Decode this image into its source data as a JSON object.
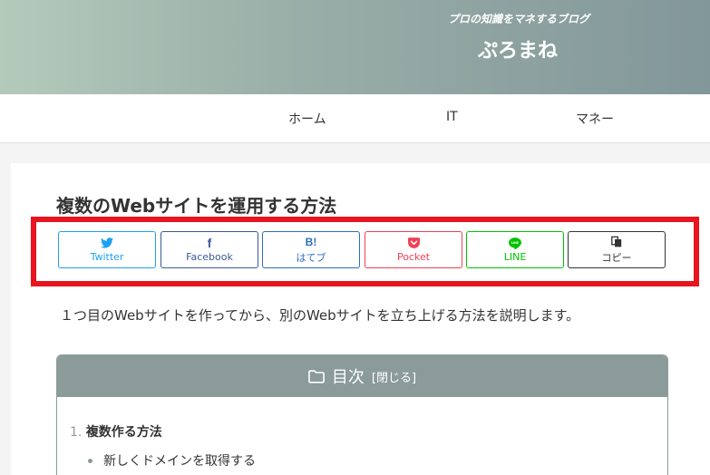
{
  "header": {
    "tagline": "プロの知識をマネするブログ",
    "site_title": "ぷろまね"
  },
  "nav": {
    "items": [
      {
        "label": "ホーム"
      },
      {
        "label": "IT"
      },
      {
        "label": "マネー"
      }
    ]
  },
  "article": {
    "title": "複数のWebサイトを運用する方法",
    "intro": "１つ目のWebサイトを作ってから、別のWebサイトを立ち上げる方法を説明します。"
  },
  "share_buttons": [
    {
      "label": "Twitter",
      "icon": "twitter-icon",
      "color": "#1da1f2"
    },
    {
      "label": "Facebook",
      "icon": "facebook-icon",
      "color": "#3b5998"
    },
    {
      "label": "はてブ",
      "icon": "hatena-bookmark-icon",
      "color": "#2c6ebd"
    },
    {
      "label": "Pocket",
      "icon": "pocket-icon",
      "color": "#ef4056"
    },
    {
      "label": "LINE",
      "icon": "line-icon",
      "color": "#00c300"
    },
    {
      "label": "コピー",
      "icon": "copy-icon",
      "color": "#333333"
    }
  ],
  "toc": {
    "title": "目次",
    "toggle_label": "[閉じる]",
    "items": [
      {
        "number": "1.",
        "label": "複数作る方法"
      }
    ],
    "subitems": [
      {
        "label": "新しくドメインを取得する"
      }
    ]
  },
  "colors": {
    "highlight_border": "#e8141e",
    "toc_accent": "#8a9b9a"
  }
}
